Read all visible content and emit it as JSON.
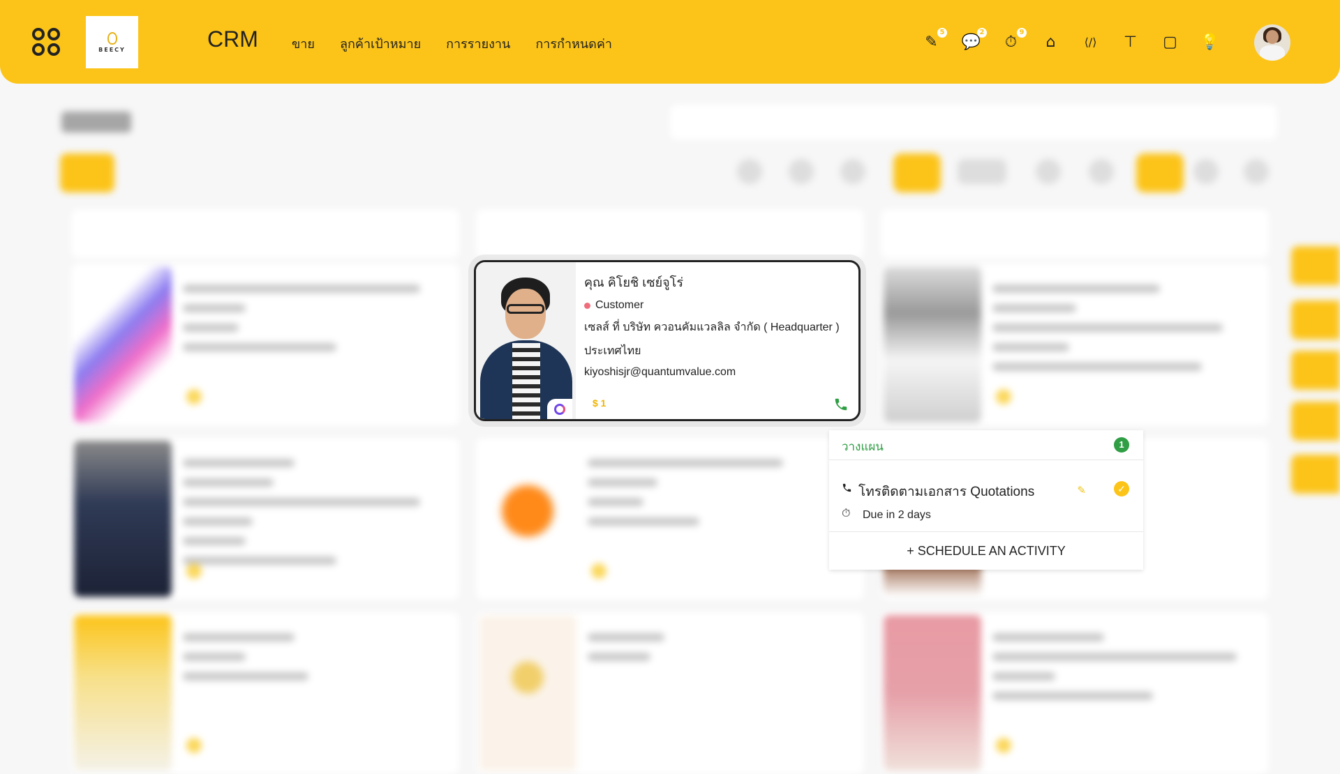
{
  "header": {
    "app_title": "CRM",
    "logo_text": "BEECY",
    "nav": [
      {
        "label": "ขาย"
      },
      {
        "label": "ลูกค้าเป้าหมาย"
      },
      {
        "label": "การรายงาน"
      },
      {
        "label": "การกำหนดค่า"
      }
    ],
    "tools": [
      {
        "icon": "edit-note-icon",
        "glyph": "✎",
        "badge": "5"
      },
      {
        "icon": "chat-icon",
        "glyph": "💬",
        "badge": "2"
      },
      {
        "icon": "timer-icon",
        "glyph": "⏱",
        "badge": "9"
      },
      {
        "icon": "building-icon",
        "glyph": "⌂",
        "badge": ""
      },
      {
        "icon": "code-icon",
        "glyph": "⟨/⟩",
        "badge": ""
      },
      {
        "icon": "paint-roller-icon",
        "glyph": "⊤",
        "badge": ""
      },
      {
        "icon": "sticky-note-icon",
        "glyph": "▢",
        "badge": ""
      },
      {
        "icon": "lightbulb-icon",
        "glyph": "💡",
        "badge": ""
      }
    ]
  },
  "contact": {
    "name": "คุณ คิโยชิ เซย์จูโร่",
    "status": "Customer",
    "company": "เซลส์ ที่ บริษัท ควอนคัมแวลลิล จำกัด ( Headquarter )",
    "country": "ประเทศไทย",
    "email": "kiyoshisjr@quantumvalue.com",
    "opportunities": "$ 1",
    "status_color": "#f06e7b"
  },
  "activity_popover": {
    "title": "วางแผน",
    "count": "1",
    "activities": [
      {
        "title": "โทรติดตามเอกสาร Quotations",
        "due": "Due in 2 days"
      }
    ],
    "schedule_label": "+ SCHEDULE AN ACTIVITY"
  },
  "colors": {
    "brand": "#fcc419",
    "success": "#2f9e44"
  }
}
